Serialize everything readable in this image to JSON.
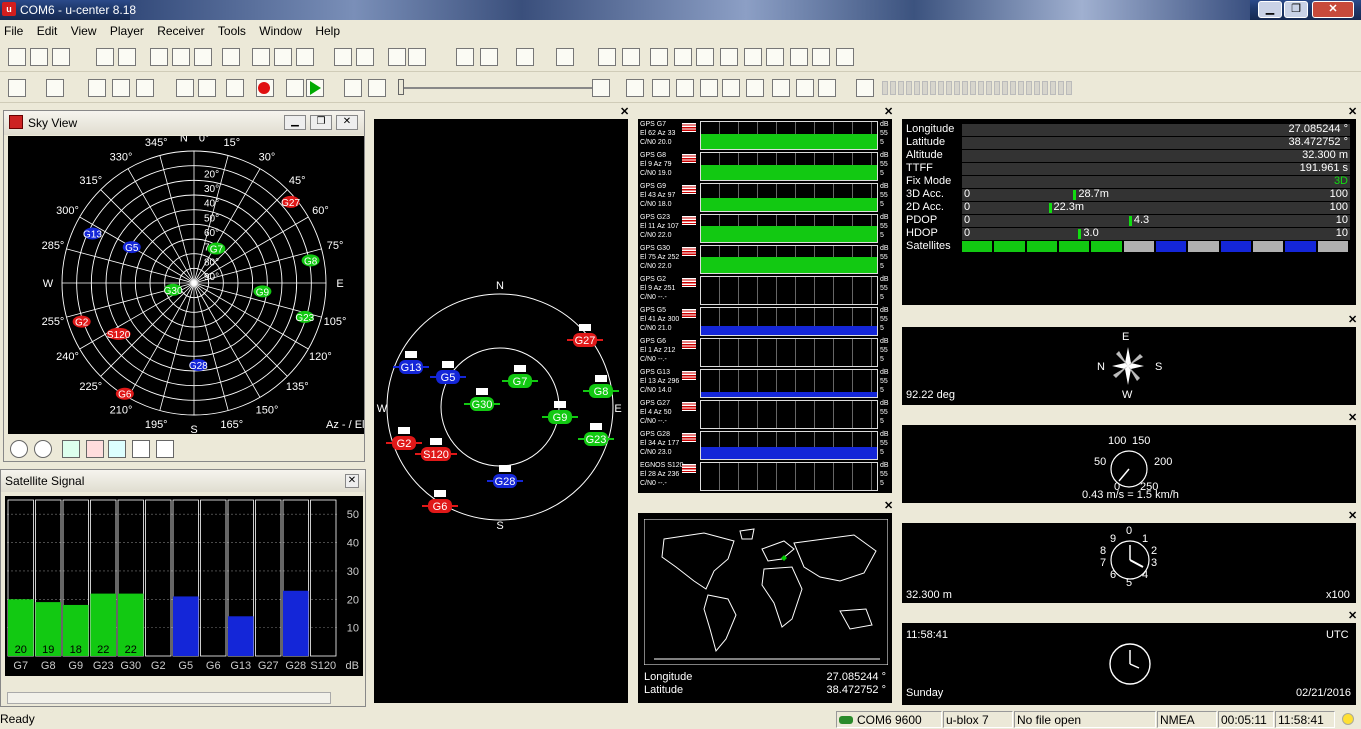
{
  "window": {
    "app_icon": "u",
    "title": "COM6 - u-center 8.18",
    "minimize": "▁",
    "maximize": "❐",
    "close": "✕"
  },
  "menu": [
    "File",
    "Edit",
    "View",
    "Player",
    "Receiver",
    "Tools",
    "Window",
    "Help"
  ],
  "skyview": {
    "title": "Sky View",
    "azimuth_labels": [
      "N",
      "0°",
      "15°",
      "30°",
      "45°",
      "60°",
      "75°",
      "E",
      "105°",
      "120°",
      "135°",
      "150°",
      "165°",
      "S",
      "195°",
      "210°",
      "225°",
      "240°",
      "255°",
      "W",
      "285°",
      "300°",
      "315°",
      "330°",
      "345°"
    ],
    "elevation_labels": [
      "90°",
      "80°",
      "70°",
      "60°",
      "50°",
      "40°",
      "30°",
      "20°"
    ],
    "footer": "Az - / El",
    "satellites": [
      {
        "id": "G7",
        "az": 33,
        "el": 62,
        "color": "green"
      },
      {
        "id": "G8",
        "az": 79,
        "el": 9,
        "color": "green"
      },
      {
        "id": "G9",
        "az": 97,
        "el": 43,
        "color": "green"
      },
      {
        "id": "G23",
        "az": 107,
        "el": 11,
        "color": "green"
      },
      {
        "id": "G30",
        "az": 252,
        "el": 75,
        "color": "green"
      },
      {
        "id": "G2",
        "az": 251,
        "el": 9,
        "color": "red"
      },
      {
        "id": "G5",
        "az": 300,
        "el": 41,
        "color": "blue"
      },
      {
        "id": "G6",
        "az": 212,
        "el": 1,
        "color": "red"
      },
      {
        "id": "G13",
        "az": 296,
        "el": 13,
        "color": "blue"
      },
      {
        "id": "G27",
        "az": 50,
        "el": 4,
        "color": "red"
      },
      {
        "id": "G28",
        "az": 177,
        "el": 34,
        "color": "blue"
      },
      {
        "id": "S120",
        "az": 236,
        "el": 28,
        "color": "red"
      }
    ]
  },
  "signal": {
    "title": "Satellite Signal",
    "yticks": [
      "50",
      "40",
      "30",
      "20",
      "10"
    ],
    "unit": "dB",
    "bars": [
      {
        "id": "G7",
        "value": 20,
        "label": "20",
        "color": "green"
      },
      {
        "id": "G8",
        "value": 19,
        "label": "19",
        "color": "green"
      },
      {
        "id": "G9",
        "value": 18,
        "label": "18",
        "color": "green"
      },
      {
        "id": "G23",
        "value": 22,
        "label": "22",
        "color": "green"
      },
      {
        "id": "G30",
        "value": 22,
        "label": "22",
        "color": "green"
      },
      {
        "id": "G2",
        "value": 0,
        "label": "",
        "color": "green"
      },
      {
        "id": "G5",
        "value": 21,
        "label": "",
        "color": "blue"
      },
      {
        "id": "G6",
        "value": 0,
        "label": "",
        "color": "green"
      },
      {
        "id": "G13",
        "value": 14,
        "label": "",
        "color": "blue"
      },
      {
        "id": "G27",
        "value": 0,
        "label": "",
        "color": "green"
      },
      {
        "id": "G28",
        "value": 23,
        "label": "",
        "color": "blue"
      },
      {
        "id": "S120",
        "value": 0,
        "label": "",
        "color": "green"
      }
    ]
  },
  "orbit": {
    "labels": [
      "N",
      "W",
      "S",
      "E"
    ],
    "sats": [
      {
        "id": "G13",
        "color": "blue"
      },
      {
        "id": "G5",
        "color": "blue"
      },
      {
        "id": "G7",
        "color": "green"
      },
      {
        "id": "G30",
        "color": "green"
      },
      {
        "id": "G9",
        "color": "green"
      },
      {
        "id": "G8",
        "color": "green"
      },
      {
        "id": "G23",
        "color": "green"
      },
      {
        "id": "G27",
        "color": "red"
      },
      {
        "id": "G2",
        "color": "red"
      },
      {
        "id": "S120",
        "color": "red"
      },
      {
        "id": "G28",
        "color": "blue"
      },
      {
        "id": "G6",
        "color": "red"
      }
    ]
  },
  "history": {
    "rows": [
      {
        "a": "GPS G7",
        "b": "El 62 Az 33",
        "c": "C/N0 20.0",
        "color": "green",
        "level": 0.55
      },
      {
        "a": "GPS G8",
        "b": "El 9 Az 79",
        "c": "C/N0 19.0",
        "color": "green",
        "level": 0.55
      },
      {
        "a": "GPS G9",
        "b": "El 43 Az 97",
        "c": "C/N0 18.0",
        "color": "green",
        "level": 0.5
      },
      {
        "a": "GPS G23",
        "b": "El 11 Az 107",
        "c": "C/N0 22.0",
        "color": "green",
        "level": 0.6
      },
      {
        "a": "GPS G30",
        "b": "El 75 Az 252",
        "c": "C/N0 22.0",
        "color": "green",
        "level": 0.6
      },
      {
        "a": "GPS G2",
        "b": "El 9 Az 251",
        "c": "C/N0 --.-",
        "color": "none",
        "level": 0
      },
      {
        "a": "GPS G5",
        "b": "El 41 Az 300",
        "c": "C/N0 21.0",
        "color": "blue",
        "level": 0.35
      },
      {
        "a": "GPS G6",
        "b": "El 1 Az 212",
        "c": "C/N0 --.-",
        "color": "none",
        "level": 0
      },
      {
        "a": "GPS G13",
        "b": "El 13 Az 296",
        "c": "C/N0 14.0",
        "color": "blue",
        "level": 0.2
      },
      {
        "a": "GPS G27",
        "b": "El 4 Az 50",
        "c": "C/N0 --.-",
        "color": "none",
        "level": 0
      },
      {
        "a": "GPS G28",
        "b": "El 34 Az 177",
        "c": "C/N0 23.0",
        "color": "blue",
        "level": 0.45
      },
      {
        "a": "EGNOS S120",
        "b": "El 28 Az 236",
        "c": "C/N0 --.-",
        "color": "none",
        "level": 0
      }
    ],
    "scale_top": "dB",
    "scale_mid": "55",
    "scale_bot": "5"
  },
  "map": {
    "lon_label": "Longitude",
    "lon": "27.085244 °",
    "lat_label": "Latitude",
    "lat": "38.472752 °"
  },
  "data": {
    "rows": [
      {
        "label": "Longitude",
        "value": "27.085244 °"
      },
      {
        "label": "Latitude",
        "value": "38.472752 °"
      },
      {
        "label": "Altitude",
        "value": "32.300 m"
      },
      {
        "label": "TTFF",
        "value": "191.961 s"
      },
      {
        "label": "Fix Mode",
        "value": "3D"
      }
    ],
    "bars": [
      {
        "label": "3D Acc.",
        "min": "0",
        "text": "28.7m",
        "max": "100",
        "frac": 0.287
      },
      {
        "label": "2D Acc.",
        "min": "0",
        "text": "22.3m",
        "max": "100",
        "frac": 0.223
      },
      {
        "label": "PDOP",
        "min": "0",
        "text": "4.3",
        "max": "10",
        "frac": 0.43
      },
      {
        "label": "HDOP",
        "min": "0",
        "text": "3.0",
        "max": "10",
        "frac": 0.3
      }
    ],
    "sat_label": "Satellites",
    "sat_cells": [
      "green",
      "green",
      "green",
      "green",
      "green",
      "gray",
      "blue",
      "gray",
      "blue",
      "gray",
      "blue",
      "gray"
    ]
  },
  "compass": {
    "E": "E",
    "N": "N",
    "S": "S",
    "W": "W",
    "value": "92.22 deg"
  },
  "speed": {
    "ticks": [
      "100",
      "150",
      "50",
      "200",
      "0",
      "250"
    ],
    "value": "0.43 m/s = 1.5 km/h"
  },
  "altimeter": {
    "value": "32.300 m",
    "scale": "x100",
    "digits": [
      "0",
      "1",
      "2",
      "3",
      "4",
      "5",
      "6",
      "7",
      "8",
      "9"
    ]
  },
  "clock": {
    "time": "11:58:41",
    "zone": "UTC",
    "day": "Sunday",
    "date": "02/21/2016"
  },
  "status": {
    "ready": "Ready",
    "port": "COM6 9600",
    "device": "u-blox 7",
    "file": "No file open",
    "protocol": "NMEA",
    "elapsed": "00:05:11",
    "time": "11:58:41"
  }
}
